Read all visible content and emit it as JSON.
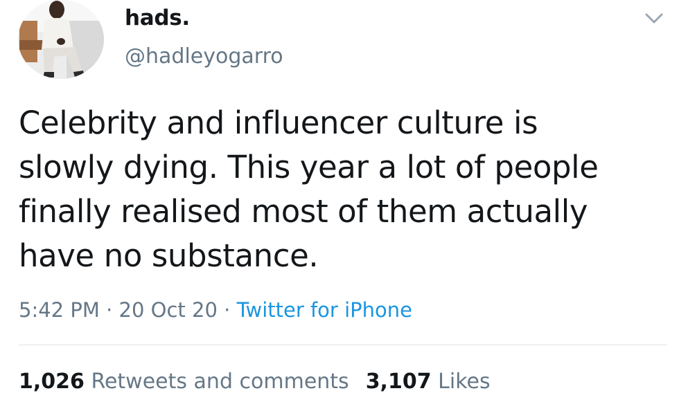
{
  "tweet": {
    "author": {
      "display_name": "hads.",
      "handle": "@hadleyogarro",
      "avatar": "profile-photo"
    },
    "menu_icon": "chevron-down-icon",
    "text": "Celebrity and influencer culture is\nslowly dying. This year a lot of people\nfinally realised most of them actually\nhave no substance.",
    "time": "5:42 PM",
    "date": "20 Oct 20",
    "separator": "·",
    "source": "Twitter for iPhone",
    "stats": {
      "retweets_count": "1,026",
      "retweets_label": "Retweets and comments",
      "likes_count": "3,107",
      "likes_label": "Likes"
    }
  },
  "colors": {
    "text": "#14171a",
    "muted": "#657786",
    "link": "#1b95e0",
    "divider": "#dfe3e7"
  }
}
